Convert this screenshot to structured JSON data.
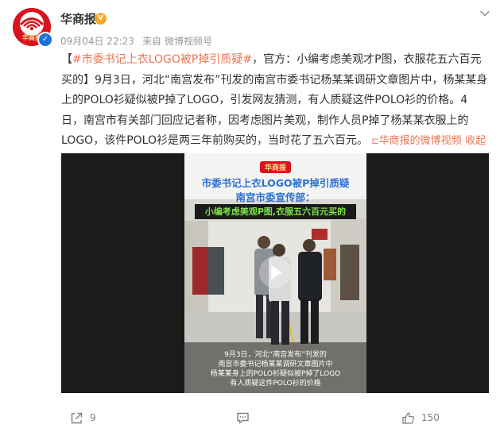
{
  "author": {
    "name": "华商报",
    "logo_text": "华商报",
    "verified": true
  },
  "meta": {
    "time": "09月04日 22:23",
    "source_prefix": "来自",
    "source": "微博视频号"
  },
  "post": {
    "bracket_open": "【",
    "topic": "#市委书记上衣LOGO被P掉引质疑#",
    "text_main": "，官方：小编考虑美观才P图，衣服花五六百元买的】9月3日，河北“南宫发布”刊发的南宫市委书记杨某某调研文章图片中，杨某某身上的POLO衫疑似被P掉了LOGO，引发网友猜测，有人质疑这件POLO衫的价格。4日，南宫市有关部门回应记者称，因考虑图片美观，制作人员P掉了杨某某衣服上的LOGO，该件POLO衫是两三年前购买的，当时花了五六百元。",
    "video_link": "华商报的微博视频",
    "collapse": "收起"
  },
  "video": {
    "title_line1": "市委书记上衣LOGO被P掉引质疑",
    "title_line2": "南宫市委宣传部：",
    "quote": "小编考虑美观P图,衣服五六百元买的",
    "subtitle_lines": [
      "9月3日，河北“南宫发布”刊发的",
      "南宫市委书记杨某某调研文章图片中",
      "杨某某身上的POLO衫疑似被P掉了LOGO",
      "有人质疑这件POLO衫的价格"
    ]
  },
  "actions": {
    "share_count": "9",
    "comment_count": "",
    "like_count": "150"
  },
  "colors": {
    "accent": "#eb7350",
    "brand_red": "#d8141e",
    "video_title_blue": "#2d6fd1",
    "quote_green": "#7ee34a"
  }
}
